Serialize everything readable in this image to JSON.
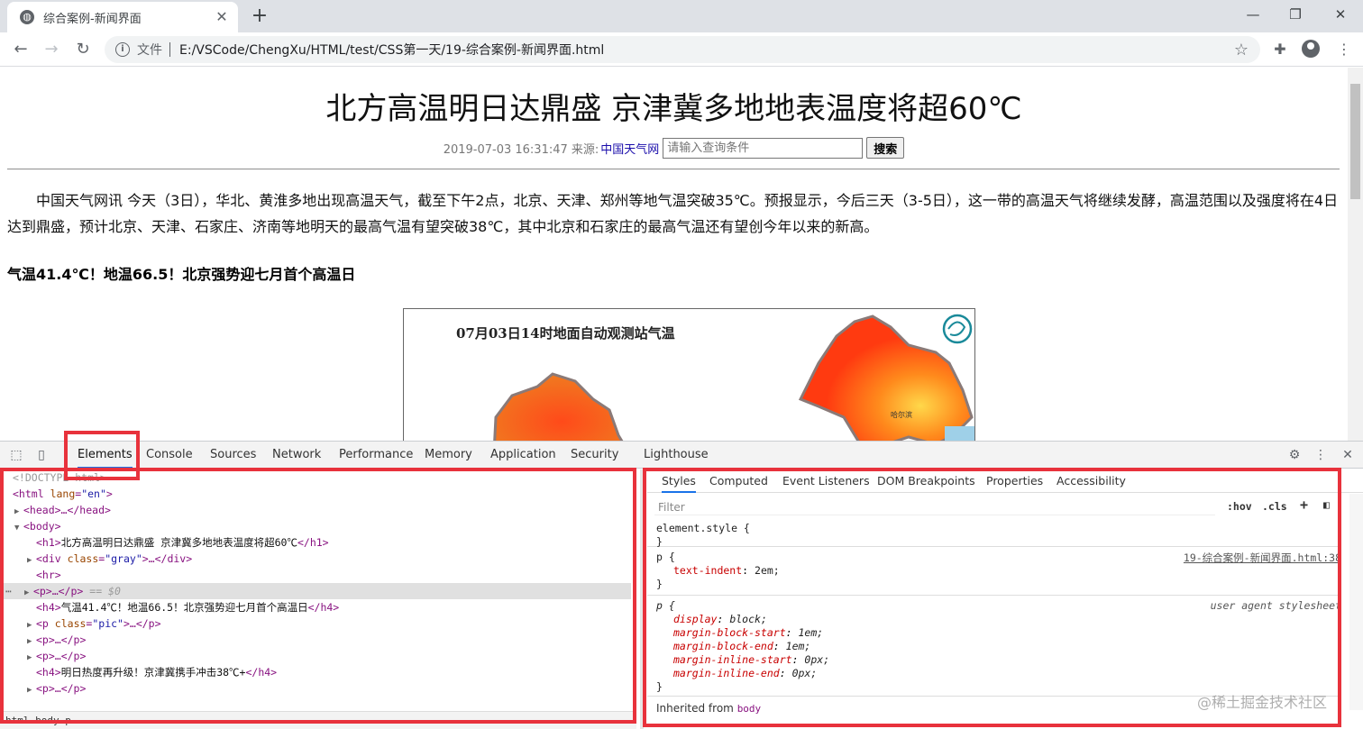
{
  "window": {
    "tab_title": "综合案例-新闻界面",
    "new_tab": "+",
    "close_tab": "✕",
    "minimize": "—",
    "maximize": "❐",
    "close_window": "✕"
  },
  "toolbar": {
    "scheme_label": "文件",
    "url": "E:/VSCode/ChengXu/HTML/test/CSS第一天/19-综合案例-新闻界面.html"
  },
  "page": {
    "h1": "北方高温明日达鼎盛 京津冀多地地表温度将超60℃",
    "date": "2019-07-03 16:31:47 来源:",
    "source": "中国天气网",
    "search_placeholder": "请输入查询条件",
    "search_button": "搜索",
    "paragraph": "中国天气网讯 今天（3日），华北、黄淮多地出现高温天气，截至下午2点，北京、天津、郑州等地气温突破35℃。预报显示，今后三天（3-5日），这一带的高温天气将继续发酵，高温范围以及强度将在4日达到鼎盛，预计北京、天津、石家庄、济南等地明天的最高气温有望突破38℃，其中北京和石家庄的最高气温还有望创今年以来的新高。",
    "h4": "气温41.4℃！地温66.5！北京强势迎七月首个高温日",
    "image_title": "07月03日14时地面自动观测站气温",
    "image_city": "哈尔滨"
  },
  "devtools": {
    "tabs": [
      "Elements",
      "Console",
      "Sources",
      "Network",
      "Performance",
      "Memory",
      "Application",
      "Security",
      "Lighthouse"
    ],
    "style_tabs": [
      "Styles",
      "Computed",
      "Event Listeners",
      "DOM Breakpoints",
      "Properties",
      "Accessibility"
    ],
    "filter_placeholder": "Filter",
    "hov": ":hov",
    "cls": ".cls",
    "plus": "+",
    "dom": {
      "doctype": "<!DOCTYPE html>",
      "html_open": "<html",
      "html_attr": "lang",
      "html_val": "\"en\"",
      "head": "<head>…</head>",
      "body": "<body>",
      "h1_open": "<h1>",
      "h1_text": "北方高温明日达鼎盛 京津冀多地地表温度将超60℃",
      "h1_close": "</h1>",
      "div_open": "<div",
      "div_attr": "class",
      "div_val": "\"gray\"",
      "div_rest": ">…</div>",
      "hr": "<hr>",
      "p_collapsed": "<p>…</p>",
      "selected_marker": "== $0",
      "h4_open": "<h4>",
      "h4_text": "气温41.4℃！地温66.5！北京强势迎七月首个高温日",
      "h4_close": "</h4>",
      "p_open": "<p",
      "p_attr": "class",
      "p_val": "\"pic\"",
      "p_rest": ">…</p>",
      "h4b_text": "明日热度再升级！京津冀携手冲击38℃+",
      "breadcrumb": "html  body  p"
    },
    "styles": {
      "element_style": "element.style {",
      "close_brace": "}",
      "p_selector": "p {",
      "p_source": "19-综合案例-新闻界面.html:38",
      "p_prop": "text-indent",
      "p_val": "2em;",
      "ua_selector": "p {",
      "ua_source": "user agent stylesheet",
      "ua_props": [
        {
          "prop": "display",
          "val": "block;"
        },
        {
          "prop": "margin-block-start",
          "val": "1em;"
        },
        {
          "prop": "margin-block-end",
          "val": "1em;"
        },
        {
          "prop": "margin-inline-start",
          "val": "0px;"
        },
        {
          "prop": "margin-inline-end",
          "val": "0px;"
        }
      ],
      "inherited_label": "Inherited from",
      "inherited_tag": "body"
    }
  },
  "watermark": "@稀土掘金技术社区"
}
